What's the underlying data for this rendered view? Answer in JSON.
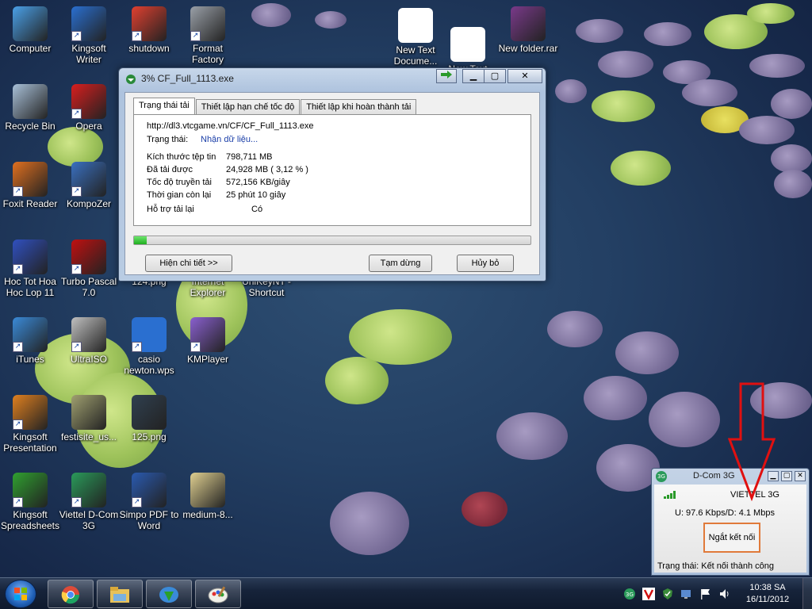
{
  "desktop_icons": [
    {
      "label": "Computer",
      "icon": "computer-icon",
      "color": "#4aa0e8"
    },
    {
      "label": "Kingsoft Writer",
      "icon": "kingsoft-writer-icon",
      "color": "#2a6fd0"
    },
    {
      "label": "shutdown",
      "icon": "shutdown-icon",
      "color": "#e04030"
    },
    {
      "label": "Format Factory",
      "icon": "format-factory-icon",
      "color": "#9aa0a8"
    },
    {
      "label": "New Text Docume...",
      "icon": "text-document-icon",
      "color": "#ffffff"
    },
    {
      "label": "New Text Document",
      "icon": "text-document-icon",
      "color": "#ffffff"
    },
    {
      "label": "New folder.rar",
      "icon": "winrar-icon",
      "color": "#7a3a8a"
    },
    {
      "label": "Recycle Bin",
      "icon": "recycle-bin-icon",
      "color": "#a8c0d8"
    },
    {
      "label": "Opera",
      "icon": "opera-icon",
      "color": "#d81e1e"
    },
    {
      "label": "Foxit Reader",
      "icon": "foxit-reader-icon",
      "color": "#e07020"
    },
    {
      "label": "KompoZer",
      "icon": "kompozer-icon",
      "color": "#3a70c0"
    },
    {
      "label": "Hoc Tot Hoa Hoc Lop 11",
      "icon": "chemistry-icon",
      "color": "#3050c0"
    },
    {
      "label": "Turbo Pascal 7.0",
      "icon": "turbo-pascal-icon",
      "color": "#c01010"
    },
    {
      "label": "124.png",
      "icon": "image-file-icon",
      "color": "#506070"
    },
    {
      "label": "Internet Explorer",
      "icon": "internet-explorer-icon",
      "color": "#3aa0e0"
    },
    {
      "label": "UniKeyNT - Shortcut",
      "icon": "unikey-icon",
      "color": "#d02020"
    },
    {
      "label": "iTunes",
      "icon": "itunes-icon",
      "color": "#3a8ad8"
    },
    {
      "label": "UltraISO",
      "icon": "ultraiso-icon",
      "color": "#c0c0c0"
    },
    {
      "label": "casio newton.wps",
      "icon": "wps-document-icon",
      "color": "#2a6fd0"
    },
    {
      "label": "KMPlayer",
      "icon": "kmplayer-icon",
      "color": "#8a60d0"
    },
    {
      "label": "Kingsoft Presentation",
      "icon": "kingsoft-presentation-icon",
      "color": "#e08020"
    },
    {
      "label": "festisite_us...",
      "icon": "image-file-icon",
      "color": "#a0a070"
    },
    {
      "label": "125.png",
      "icon": "image-file-icon",
      "color": "#304050"
    },
    {
      "label": "Kingsoft Spreadsheets",
      "icon": "kingsoft-spreadsheets-icon",
      "color": "#30a030"
    },
    {
      "label": "Viettel D-Com 3G",
      "icon": "viettel-dcom-icon",
      "color": "#2a9a5a"
    },
    {
      "label": "Simpo PDF to Word",
      "icon": "pdf-to-word-icon",
      "color": "#2a5ab0"
    },
    {
      "label": "medium-8...",
      "icon": "image-file-icon",
      "color": "#e0d090"
    }
  ],
  "download_window": {
    "title": "3% CF_Full_1113.exe",
    "tabs": [
      "Trạng thái tải",
      "Thiết lập hạn chế tốc độ",
      "Thiết lập khi hoàn thành tải"
    ],
    "url": "http://dl3.vtcgame.vn/CF/CF_Full_1113.exe",
    "status_label": "Trạng thái:",
    "status_value": "Nhận dữ liệu...",
    "rows": [
      {
        "label": "Kích thước tệp tin",
        "value": "798,711  MB"
      },
      {
        "label": "Đã tải được",
        "value": "24,928  MB  ( 3,12 % )"
      },
      {
        "label": "Tốc độ truyền tải",
        "value": "572,156  KB/giây"
      },
      {
        "label": "Thời gian còn lại",
        "value": "25 phút 10 giây"
      },
      {
        "label": "Hỗ trợ tải lại",
        "value": "Có"
      }
    ],
    "progress_percent": 3.12,
    "buttons": {
      "details": "Hiện chi tiết >>",
      "pause": "Tạm dừng",
      "cancel": "Hủy bỏ"
    }
  },
  "dcom": {
    "title": "D-Com 3G",
    "carrier": "VIETTEL  3G",
    "speed": "U: 97.6 Kbps/D: 4.1 Mbps",
    "disconnect": "Ngắt kết nối",
    "status": "Trạng thái: Kết nối thành công"
  },
  "taskbar": {
    "buttons": [
      "chrome-icon",
      "file-explorer-icon",
      "internet-download-manager-icon",
      "paint-icon"
    ],
    "tray_icons": [
      "dcom-tray-icon",
      "antivirus-tray-icon",
      "security-tray-icon",
      "network-tray-icon",
      "flag-tray-icon",
      "volume-icon"
    ],
    "time": "10:38 SA",
    "date": "16/11/2012"
  },
  "colors": {
    "accent_red": "#e01010",
    "progress_green": "#1fae1f",
    "status_blue": "#1a3ea8"
  }
}
